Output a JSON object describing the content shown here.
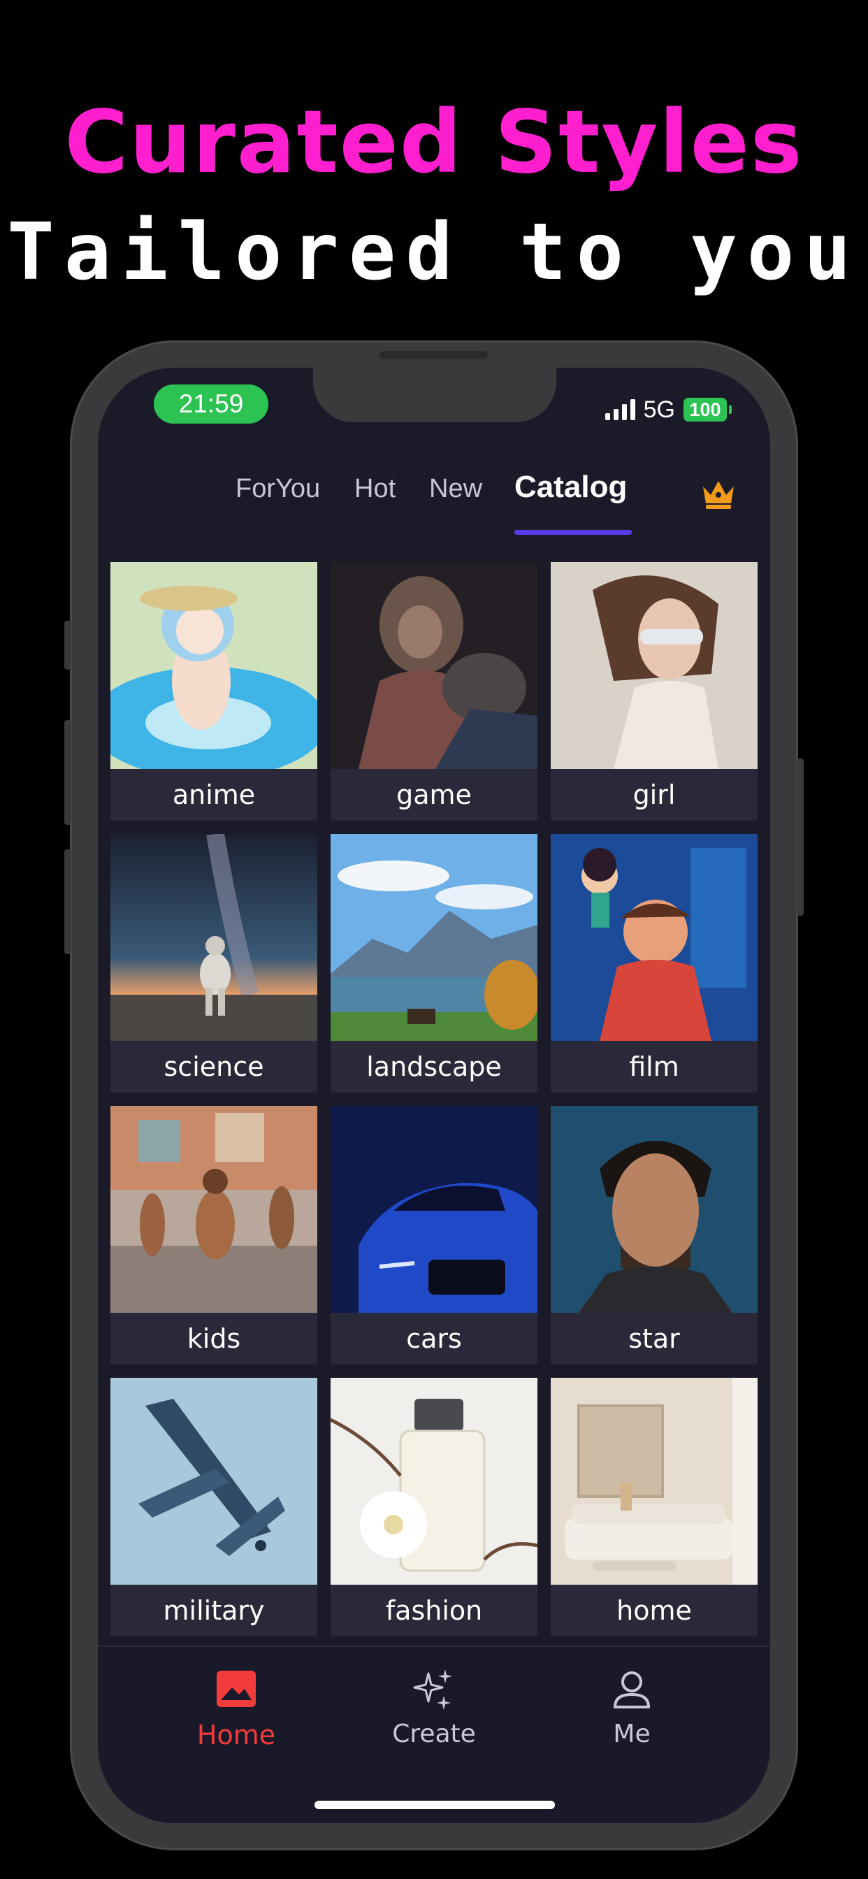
{
  "promo": {
    "headline": "Curated Styles",
    "subheadline": "Tailored to you",
    "headline_color": "#ff1fcf"
  },
  "status_bar": {
    "time": "21:59",
    "network": "5G",
    "battery": "100",
    "time_pill_color": "#2cc353"
  },
  "tabs": [
    {
      "label": "ForYou",
      "active": false
    },
    {
      "label": "Hot",
      "active": false
    },
    {
      "label": "New",
      "active": false
    },
    {
      "label": "Catalog",
      "active": true
    }
  ],
  "premium_icon": "crown-icon",
  "accent": "#5b3df0",
  "catalog": [
    {
      "label": "anime",
      "thumb": "anime-girl-pool-float-thumbnail"
    },
    {
      "label": "game",
      "thumb": "armored-monkey-warrior-thumbnail"
    },
    {
      "label": "girl",
      "thumb": "model-sunglasses-thumbnail"
    },
    {
      "label": "science",
      "thumb": "astronaut-milky-way-thumbnail"
    },
    {
      "label": "landscape",
      "thumb": "mountain-lake-thumbnail"
    },
    {
      "label": "film",
      "thumb": "animated-characters-thumbnail"
    },
    {
      "label": "kids",
      "thumb": "children-running-street-thumbnail"
    },
    {
      "label": "cars",
      "thumb": "blue-sports-car-thumbnail"
    },
    {
      "label": "star",
      "thumb": "man-portrait-blue-thumbnail"
    },
    {
      "label": "military",
      "thumb": "fighter-jet-thumbnail"
    },
    {
      "label": "fashion",
      "thumb": "perfume-bottle-flowers-thumbnail"
    },
    {
      "label": "home",
      "thumb": "living-room-sofa-thumbnail"
    }
  ],
  "bottom_nav": [
    {
      "label": "Home",
      "icon": "image-icon",
      "active": true
    },
    {
      "label": "Create",
      "icon": "sparkles-icon",
      "active": false
    },
    {
      "label": "Me",
      "icon": "person-icon",
      "active": false
    }
  ],
  "active_nav_color": "#f23b3b"
}
